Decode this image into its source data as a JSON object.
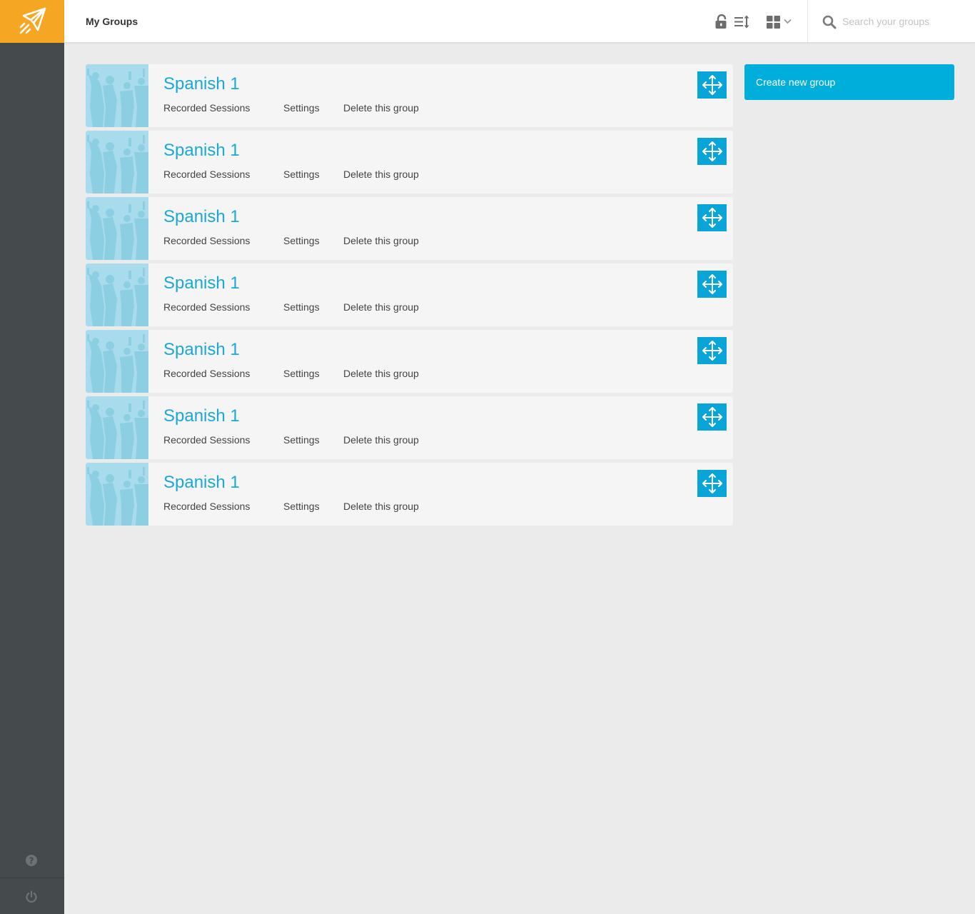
{
  "header": {
    "title": "My Groups",
    "search_placeholder": "Search your groups",
    "search_value": ""
  },
  "icons": {
    "logo": "paper-plane-logo",
    "lock": "unlock-icon",
    "sort": "sort-icon",
    "view": "grid-view-icon",
    "search": "search-icon",
    "move": "move-arrows-icon",
    "help": "help-icon",
    "power": "power-icon"
  },
  "colors": {
    "accent": "#00aedb",
    "brand": "#f5a623",
    "sidebar": "#454a4d",
    "title_text": "#1aa8d6"
  },
  "groups": [
    {
      "name": "Spanish 1",
      "recorded_label": "Recorded Sessions",
      "settings_label": "Settings",
      "delete_label": "Delete this group"
    },
    {
      "name": "Spanish 1",
      "recorded_label": "Recorded Sessions",
      "settings_label": "Settings",
      "delete_label": "Delete this group"
    },
    {
      "name": "Spanish 1",
      "recorded_label": "Recorded Sessions",
      "settings_label": "Settings",
      "delete_label": "Delete this group"
    },
    {
      "name": "Spanish 1",
      "recorded_label": "Recorded Sessions",
      "settings_label": "Settings",
      "delete_label": "Delete this group"
    },
    {
      "name": "Spanish 1",
      "recorded_label": "Recorded Sessions",
      "settings_label": "Settings",
      "delete_label": "Delete this group"
    },
    {
      "name": "Spanish 1",
      "recorded_label": "Recorded Sessions",
      "settings_label": "Settings",
      "delete_label": "Delete this group"
    },
    {
      "name": "Spanish 1",
      "recorded_label": "Recorded Sessions",
      "settings_label": "Settings",
      "delete_label": "Delete this group"
    }
  ],
  "actions": {
    "create_label": "Create new group"
  }
}
